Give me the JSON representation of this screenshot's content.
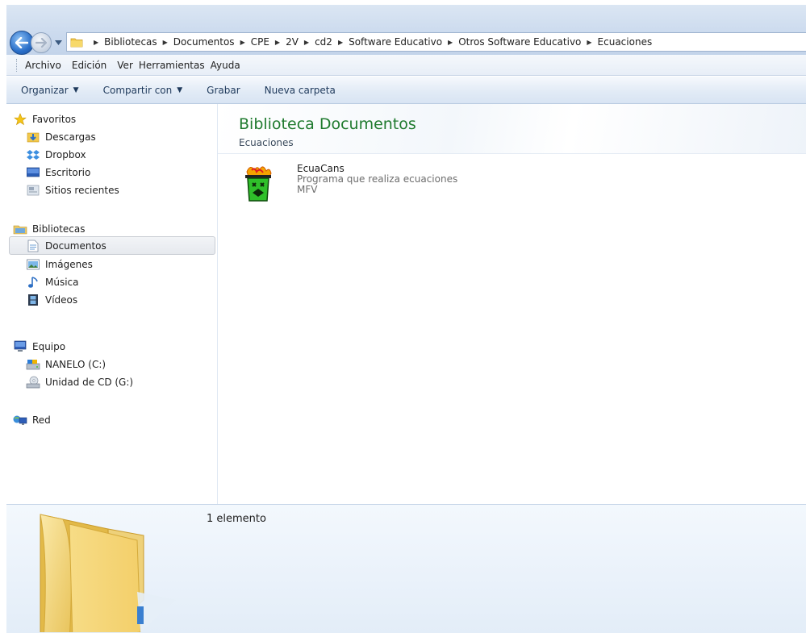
{
  "address": {
    "crumbs": [
      "Bibliotecas",
      "Documentos",
      "CPE",
      "2V",
      "cd2",
      "Software Educativo",
      "Otros Software Educativo",
      "Ecuaciones"
    ]
  },
  "menu": {
    "items": [
      "Archivo",
      "Edición",
      "Ver",
      "Herramientas",
      "Ayuda"
    ]
  },
  "toolbar": {
    "organize": "Organizar",
    "share": "Compartir con",
    "burn": "Grabar",
    "new_folder": "Nueva carpeta"
  },
  "sidebar": {
    "favorites": {
      "label": "Favoritos",
      "items": [
        "Descargas",
        "Dropbox",
        "Escritorio",
        "Sitios recientes"
      ]
    },
    "libraries": {
      "label": "Bibliotecas",
      "items": [
        "Documentos",
        "Imágenes",
        "Música",
        "Vídeos"
      ]
    },
    "computer": {
      "label": "Equipo",
      "items": [
        "NANELO (C:)",
        "Unidad de CD (G:)"
      ]
    },
    "network": {
      "label": "Red"
    }
  },
  "library": {
    "title": "Biblioteca Documentos",
    "subtitle": "Ecuaciones"
  },
  "files": [
    {
      "name": "EcuaCans",
      "description": "Programa que realiza ecuaciones",
      "author": "MFV"
    }
  ],
  "details": {
    "count": "1 elemento"
  },
  "colors": {
    "library_title": "#1f7a2e",
    "command_text": "#1e395b",
    "selection_border": "#c8ccd3"
  }
}
